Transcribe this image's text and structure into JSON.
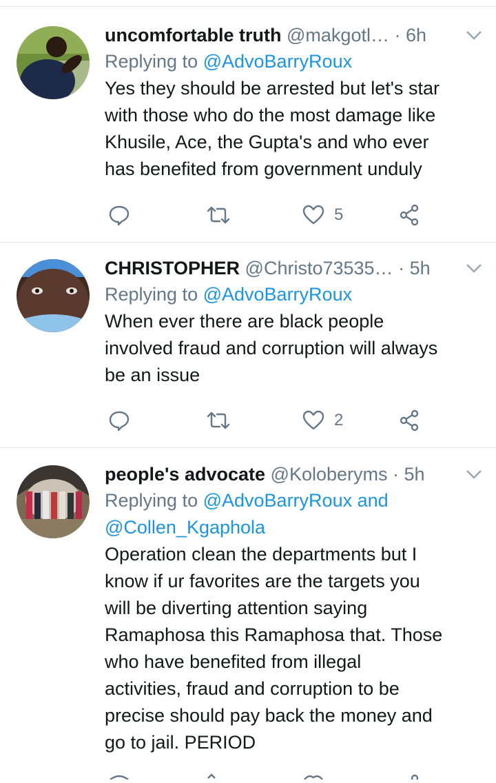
{
  "tweets": [
    {
      "name": "uncomfortable truth",
      "handle": "@makgotl…",
      "dot": "·",
      "time": "6h",
      "reply_prefix": "Replying to ",
      "reply_to": "@AdvoBarryRoux",
      "reply_to_2": "",
      "text_lines": [
        "Yes they should be arrested but let's star",
        "with those who do the most damage like",
        "Khusile, Ace, the Gupta's and who ever",
        "has benefited from government unduly"
      ],
      "likes": "5"
    },
    {
      "name": "CHRISTOPHER",
      "handle": "@Christo73535…",
      "dot": "·",
      "time": "5h",
      "reply_prefix": "Replying to ",
      "reply_to": "@AdvoBarryRoux",
      "reply_to_2": "",
      "text_lines": [
        "When ever there are black people",
        "involved fraud and corruption will always",
        "be an issue"
      ],
      "likes": "2"
    },
    {
      "name": "people's advocate",
      "handle": "@Koloberyms",
      "dot": "·",
      "time": "5h",
      "reply_prefix": "Replying to ",
      "reply_to": "@AdvoBarryRoux and",
      "reply_to_2": "@Collen_Kgaphola",
      "text_lines": [
        "Operation clean the departments but I",
        "know if ur favorites are the targets you",
        "will be diverting attention saying",
        "Ramaphosa this Ramaphosa that. Those",
        "who have benefited from illegal",
        "activities, fraud and corruption to be",
        "precise should pay back the money and",
        "go to jail. PERIOD"
      ],
      "likes": ""
    }
  ],
  "colors": {
    "text": "#14171a",
    "muted": "#657786",
    "link": "#1b95e0",
    "divider": "#e1e8ed"
  },
  "icons": [
    "reply-icon",
    "retweet-icon",
    "like-icon",
    "share-icon",
    "chevron-down-icon"
  ]
}
